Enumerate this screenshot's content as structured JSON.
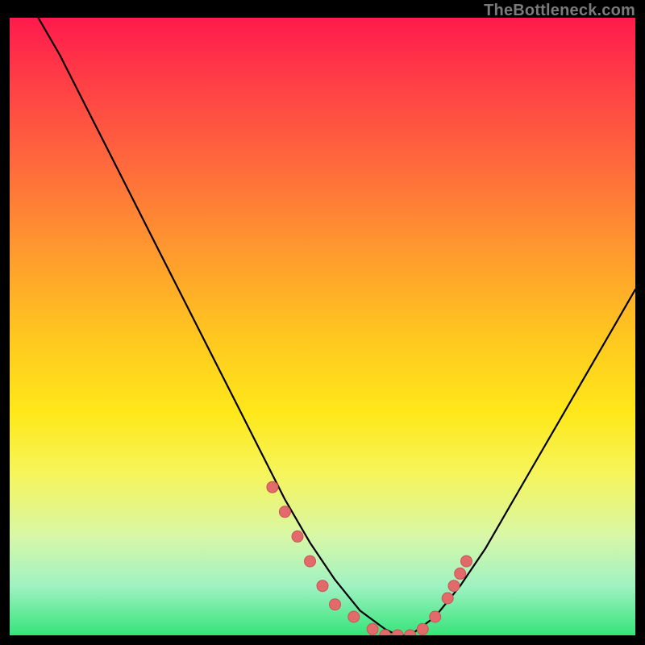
{
  "watermark": {
    "text": "TheBottleneck.com"
  },
  "colors": {
    "curve_stroke": "#000000",
    "marker_fill": "#e26a6a",
    "marker_stroke": "#c85656"
  },
  "chart_data": {
    "type": "line",
    "title": "",
    "xlabel": "",
    "ylabel": "",
    "xlim": [
      0,
      100
    ],
    "ylim": [
      0,
      100
    ],
    "x": [
      0,
      4,
      8,
      12,
      16,
      20,
      24,
      28,
      32,
      36,
      40,
      44,
      48,
      52,
      56,
      60,
      62,
      64,
      68,
      72,
      76,
      80,
      84,
      88,
      92,
      96,
      100
    ],
    "values": [
      107,
      101,
      94,
      86,
      78,
      70,
      62,
      54,
      46,
      38,
      30,
      22,
      15,
      9,
      4,
      1,
      0,
      0,
      3,
      8,
      14,
      21,
      28,
      35,
      42,
      49,
      56
    ],
    "markers": {
      "x": [
        42,
        44,
        46,
        48,
        50,
        52,
        55,
        58,
        60,
        62,
        64,
        66,
        68,
        70,
        71,
        72,
        73
      ],
      "values": [
        24,
        20,
        16,
        12,
        8,
        5,
        3,
        1,
        0,
        0,
        0,
        1,
        3,
        6,
        8,
        10,
        12
      ]
    }
  }
}
